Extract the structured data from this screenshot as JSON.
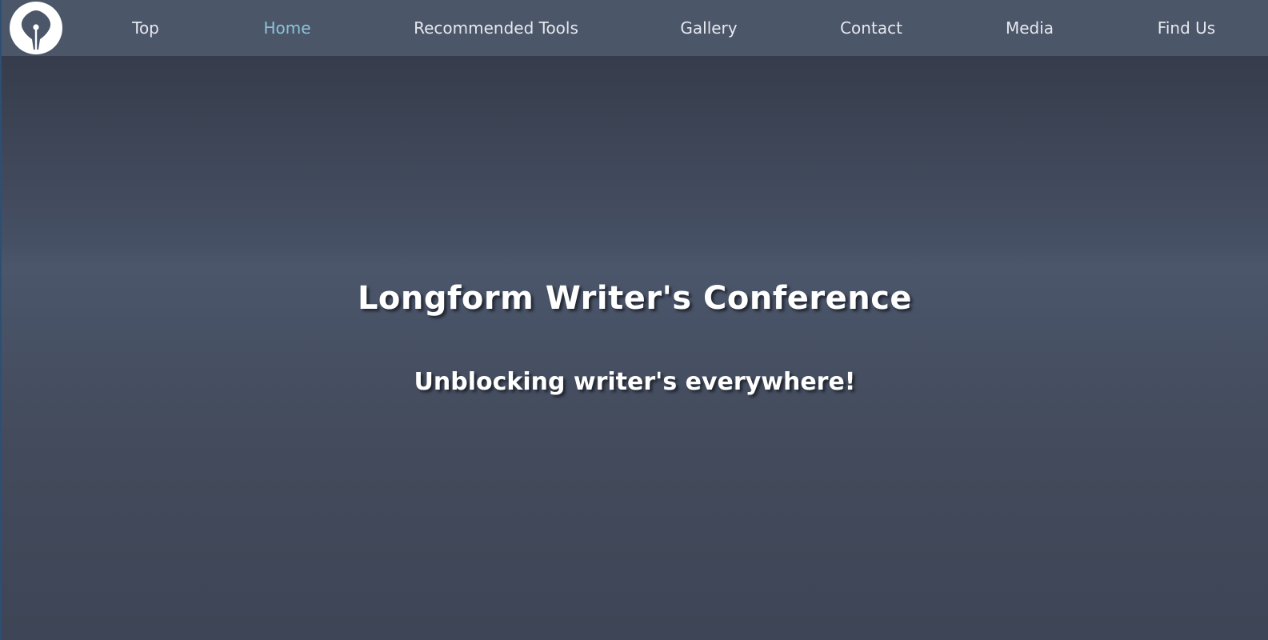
{
  "nav": {
    "logo_icon": "fountain-pen-nib-icon",
    "items": [
      {
        "label": "Top",
        "active": false
      },
      {
        "label": "Home",
        "active": true
      },
      {
        "label": "Recommended Tools",
        "active": false
      },
      {
        "label": "Gallery",
        "active": false
      },
      {
        "label": "Contact",
        "active": false
      },
      {
        "label": "Media",
        "active": false
      },
      {
        "label": "Find Us",
        "active": false
      }
    ]
  },
  "hero": {
    "title": "Longform Writer's Conference",
    "subtitle": "Unblocking writer's everywhere!"
  },
  "colors": {
    "nav_background": "#4b5669",
    "nav_text": "#e6e9ee",
    "nav_active": "#8ec3da",
    "hero_text": "#ffffff"
  }
}
